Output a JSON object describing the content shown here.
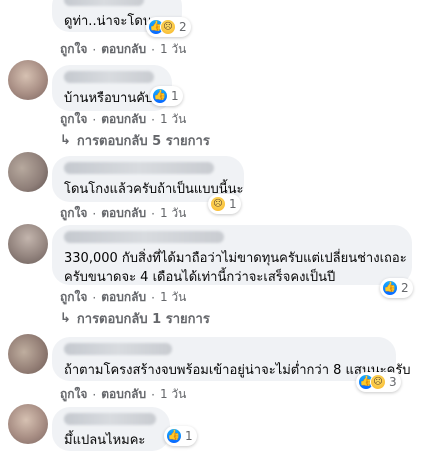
{
  "common": {
    "like_label": "ถูกใจ",
    "reply_label": "ตอบกลับ",
    "separator": "·"
  },
  "comments": [
    {
      "text": "ดูท่า..น่าจะโดน",
      "reaction_count": "2",
      "time": "1 วัน"
    },
    {
      "text": "บ้านหรือบานคับ",
      "reaction_count": "1",
      "time": "1 วัน",
      "replies_text": "การตอบกลับ 5 รายการ"
    },
    {
      "text": "โดนโกงแล้วครับถ้าเป็นแบบนี้นะ",
      "reaction_count": "1",
      "time": "1 วัน"
    },
    {
      "text_lines": [
        "330,000 กับสิ่งที่ได้มาถือว่าไม่ขาดทุนครับแต่เปลี่ยนช่างเถอะ",
        "ครับขนาดจะ 4 เดือนได้เท่านี้กว่าจะเสร็จคงเป็นปี"
      ],
      "reaction_count": "2",
      "time": "1 วัน",
      "replies_text": "การตอบกลับ 1 รายการ"
    },
    {
      "text": "ถ้าตามโครงสร้างจบพร้อมเข้าอยู่น่าจะไม่ต่ำกว่า 8 แสนนะครับ",
      "reaction_count": "3",
      "time": "1 วัน"
    },
    {
      "text": "มึ้แปลนไหมคะ",
      "reaction_count": "1"
    }
  ],
  "icons": {
    "like": "like-icon",
    "sad": "sad-icon",
    "reply_arrow": "reply-arrow-icon"
  },
  "colors": {
    "bubble": "#f0f2f5",
    "secondary_text": "#65676b",
    "like_blue": "#0866ff",
    "sad_yellow": "#f7b125"
  }
}
